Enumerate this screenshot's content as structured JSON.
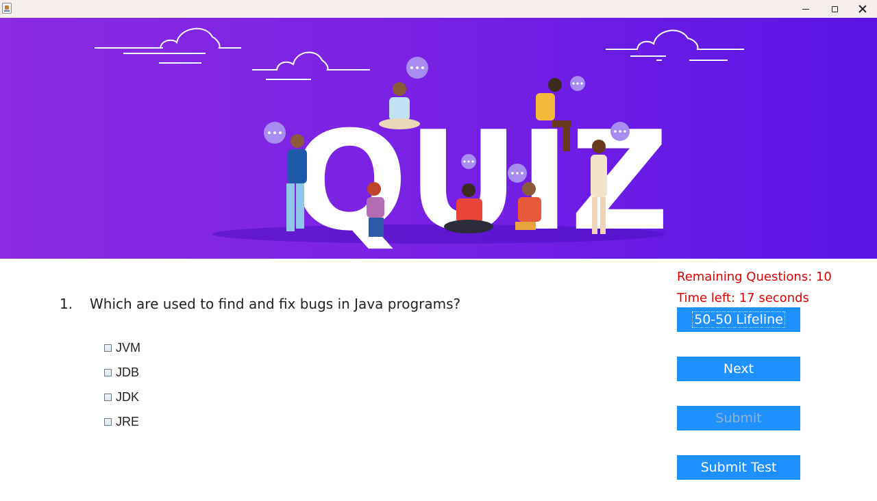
{
  "window": {
    "icon": "java-cup-icon",
    "controls": [
      "minimize-icon",
      "maximize-icon",
      "close-icon"
    ]
  },
  "banner": {
    "word": "QUIZ",
    "colors": {
      "start": "#8a2be2",
      "end": "#5a14e6"
    }
  },
  "question": {
    "number": "1.",
    "text": "Which are used to find and fix bugs in Java programs?",
    "options": [
      "JVM",
      "JDB",
      "JDK",
      "JRE"
    ]
  },
  "status": {
    "remaining": "Remaining Questions: 10",
    "time_left": "Time left: 17 seconds",
    "color": "#e00000"
  },
  "buttons": {
    "lifeline": "50-50 Lifeline",
    "next": "Next",
    "submit": "Submit",
    "submit_test": "Submit Test",
    "color": "#1e90ff"
  }
}
